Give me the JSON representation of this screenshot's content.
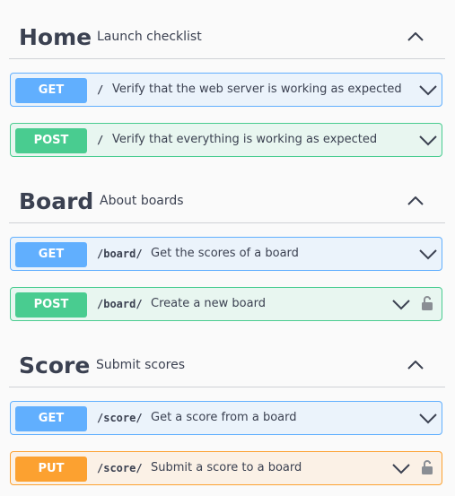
{
  "sections": [
    {
      "title": "Home",
      "description": "Launch checklist",
      "icon": "chevron-up-icon",
      "operations": [
        {
          "method": "GET",
          "path": "/",
          "summary": "Verify that the web server is working as expected",
          "locked": false
        },
        {
          "method": "POST",
          "path": "/",
          "summary": "Verify that everything is working as expected",
          "locked": false
        }
      ]
    },
    {
      "title": "Board",
      "description": "About boards",
      "icon": "chevron-up-icon",
      "operations": [
        {
          "method": "GET",
          "path": "/board/",
          "summary": "Get the scores of a board",
          "locked": false
        },
        {
          "method": "POST",
          "path": "/board/",
          "summary": "Create a new board",
          "locked": true
        }
      ]
    },
    {
      "title": "Score",
      "description": "Submit scores",
      "icon": "chevron-up-icon",
      "operations": [
        {
          "method": "GET",
          "path": "/score/",
          "summary": "Get a score from a board",
          "locked": false
        },
        {
          "method": "PUT",
          "path": "/score/",
          "summary": "Submit a score to a board",
          "locked": true
        }
      ]
    }
  ],
  "colors": {
    "get": "#61affe",
    "post": "#49cc90",
    "put": "#fca130",
    "text": "#3b4151",
    "background": "#fafafa"
  }
}
